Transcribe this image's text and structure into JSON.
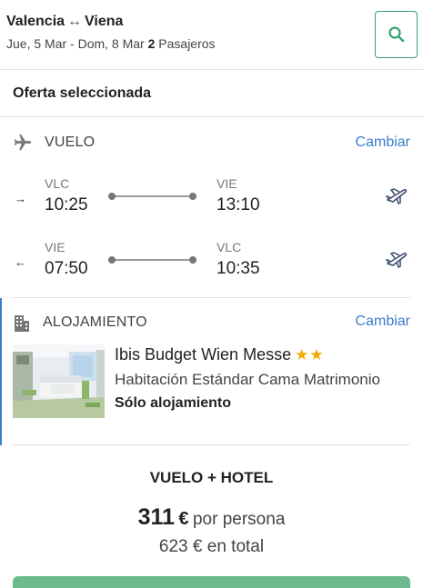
{
  "header": {
    "origin": "Valencia",
    "arrow": "↔",
    "destination": "Viena",
    "dates": "Jue, 5 Mar - Dom, 8 Mar",
    "passengers_count": "2",
    "passengers_label": "Pasajeros"
  },
  "offer": {
    "title": "Oferta seleccionada"
  },
  "flight": {
    "label": "VUELO",
    "change": "Cambiar",
    "legs": [
      {
        "dir": "→",
        "from_code": "VLC",
        "from_time": "10:25",
        "to_code": "VIE",
        "to_time": "13:10"
      },
      {
        "dir": "←",
        "from_code": "VIE",
        "from_time": "07:50",
        "to_code": "VLC",
        "to_time": "10:35"
      }
    ]
  },
  "lodging": {
    "label": "ALOJAMIENTO",
    "change": "Cambiar",
    "hotel_name": "Ibis Budget Wien Messe",
    "stars": "★★",
    "room": "Habitación Estándar Cama Matrimonio",
    "board": "Sólo alojamiento"
  },
  "price": {
    "package": "VUELO + HOTEL",
    "per_person_amount": "311",
    "currency": "€",
    "per_person_label": "por persona",
    "total": "623 € en total"
  },
  "colors": {
    "accent_green": "#35a36d",
    "link_blue": "#3d7dcc",
    "star": "#f2a900",
    "cta": "#6cba8d"
  }
}
